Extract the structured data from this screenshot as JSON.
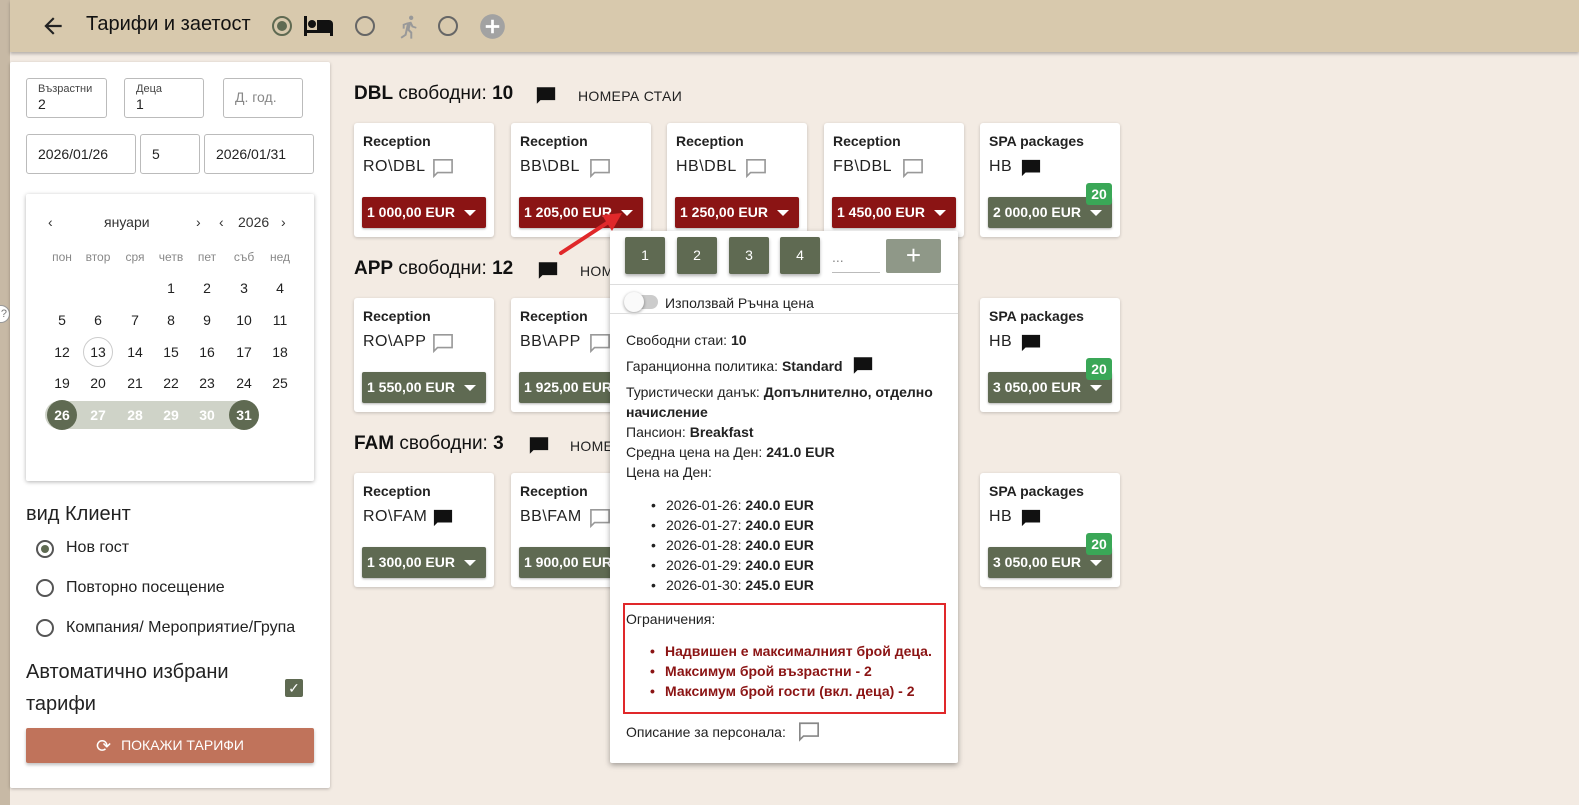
{
  "header": {
    "title": "Тарифи и заетост",
    "modes": [
      "bed",
      "walk",
      "add"
    ]
  },
  "search": {
    "adults_label": "Възрастни",
    "adults": "2",
    "children_label": "Деца",
    "children": "1",
    "child_age_placeholder": "Д. год.",
    "date_from": "2026/01/26",
    "nights": "5",
    "date_to": "2026/01/31"
  },
  "calendar": {
    "month": "януари",
    "year": "2026",
    "weekdays": [
      "пон",
      "втор",
      "сря",
      "четв",
      "пет",
      "съб",
      "нед"
    ],
    "rows": [
      [
        "",
        "",
        "",
        "1",
        "2",
        "3",
        "4"
      ],
      [
        "5",
        "6",
        "7",
        "8",
        "9",
        "10",
        "11"
      ],
      [
        "12",
        "13",
        "14",
        "15",
        "16",
        "17",
        "18"
      ],
      [
        "19",
        "20",
        "21",
        "22",
        "23",
        "24",
        "25"
      ],
      [
        "26",
        "27",
        "28",
        "29",
        "30",
        "31",
        ""
      ]
    ]
  },
  "client": {
    "title": "вид Клиент",
    "options": [
      "Нов гост",
      "Повторно посещение",
      "Компания/ Мероприятие/Група"
    ],
    "auto_line1": "Автоматично избрани",
    "auto_line2": "тарифи",
    "show_button": "ПОКАЖИ ТАРИФИ"
  },
  "rooms": [
    {
      "name": "DBL",
      "free_label": "свободни:",
      "free": "10",
      "link": "НОМЕРА СТАИ",
      "cards": [
        {
          "source": "Reception",
          "rate": "RO\\DBL",
          "price": "1 000,00 EUR"
        },
        {
          "source": "Reception",
          "rate": "BB\\DBL",
          "price": "1 205,00 EUR"
        },
        {
          "source": "Reception",
          "rate": "HB\\DBL",
          "price": "1 250,00 EUR"
        },
        {
          "source": "Reception",
          "rate": "FB\\DBL",
          "price": "1 450,00 EUR"
        },
        {
          "source": "SPA packages",
          "rate": "HB",
          "price": "2 000,00 EUR",
          "badge": "20"
        }
      ]
    },
    {
      "name": "APP",
      "free_label": "свободни:",
      "free": "12",
      "link": "НОМ",
      "cards": [
        {
          "source": "Reception",
          "rate": "RO\\APP",
          "price": "1 550,00 EUR"
        },
        {
          "source": "Reception",
          "rate": "BB\\APP",
          "price": "1 925,00 EUR"
        },
        {
          "source": "SPA packages",
          "rate": "HB",
          "price": "3 050,00 EUR",
          "badge": "20"
        }
      ]
    },
    {
      "name": "FAM",
      "free_label": "свободни:",
      "free": "3",
      "link": "НОМЕ",
      "cards": [
        {
          "source": "Reception",
          "rate": "RO\\FAM",
          "price": "1 300,00 EUR"
        },
        {
          "source": "Reception",
          "rate": "BB\\FAM",
          "price": "1 900,00 EUR"
        },
        {
          "source": "SPA packages",
          "rate": "HB",
          "price": "3 050,00 EUR",
          "badge": "20"
        }
      ]
    }
  ],
  "popup": {
    "qty": [
      "1",
      "2",
      "3",
      "4"
    ],
    "qty_placeholder": "...",
    "manual_price": "Използвай Ръчна цена",
    "free_rooms_label": "Свободни стаи:",
    "free_rooms": "10",
    "guarantee_label": "Гаранционна политика:",
    "guarantee": "Standard",
    "tax_label": "Туристически данък:",
    "tax_line1": "Допълнително, отделно",
    "tax_line2": "начисление",
    "board_label": "Пансион:",
    "board": "Breakfast",
    "avg_label": "Средна цена на Ден:",
    "avg": "241.0 EUR",
    "price_per_day_label": "Цена на Ден:",
    "days": [
      {
        "date": "2026-01-26:",
        "price": "240.0 EUR"
      },
      {
        "date": "2026-01-27:",
        "price": "240.0 EUR"
      },
      {
        "date": "2026-01-28:",
        "price": "240.0 EUR"
      },
      {
        "date": "2026-01-29:",
        "price": "240.0 EUR"
      },
      {
        "date": "2026-01-30:",
        "price": "245.0 EUR"
      }
    ],
    "restrictions_label": "Ограничения:",
    "restrictions": [
      "Надвишен е максималният брой деца.",
      "Максимум брой възрастни - 2",
      "Максимум брой гости (вкл. деца) - 2"
    ],
    "staff_desc_label": "Описание за персонала:"
  },
  "colors": {
    "header": "#d8c9ad",
    "accent_green": "#5f6a52",
    "price_red": "#8b1414",
    "button_terracotta": "#c0735b",
    "badge_green": "#3aa757",
    "highlight_border": "#e0282a"
  }
}
